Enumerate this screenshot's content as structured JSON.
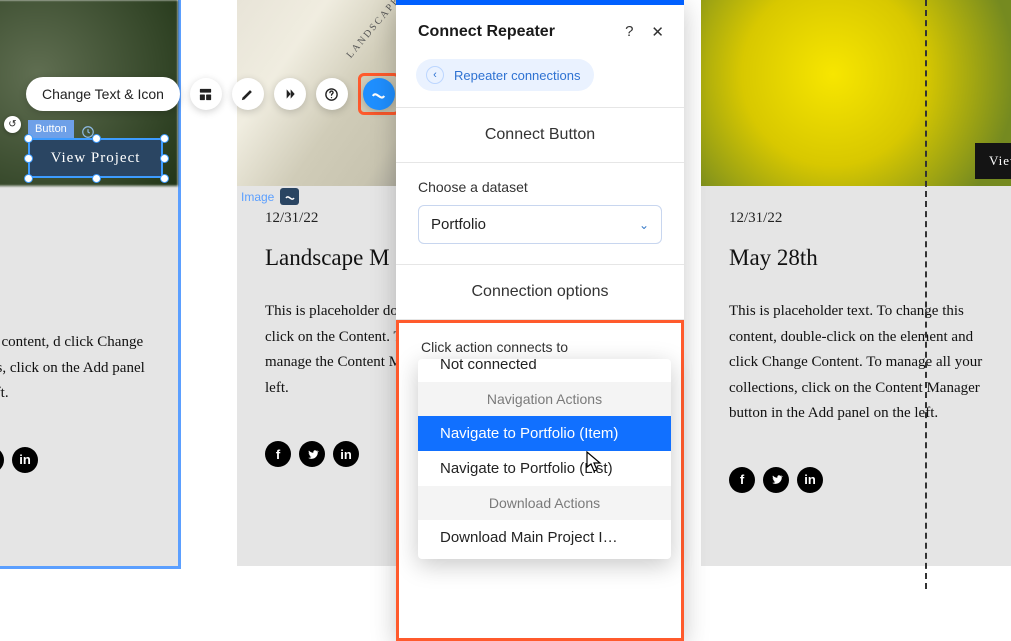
{
  "toolbar": {
    "change_text_label": "Change Text & Icon"
  },
  "selected_element": {
    "type_label": "Button",
    "button_text": "View Project"
  },
  "image_label": "Image",
  "cards": {
    "c1": {
      "text": "ange this content, d click Change ollections, click on the Add panel on the left."
    },
    "c2": {
      "date": "12/31/22",
      "title": "Landscape M",
      "text": "This is placeholder double-click on the Content. To manage the Content Manage left."
    },
    "c3": {
      "date": "12/31/22",
      "title": "May 28th",
      "text": "This is placeholder text. To change this content, double-click on the element and click Change Content. To manage all your collections, click on the Content Manager button in the Add panel on the left.",
      "button_text": "View"
    }
  },
  "panel": {
    "title": "Connect Repeater",
    "repeater_connections_label": "Repeater connections",
    "connect_button_label": "Connect Button",
    "choose_dataset_label": "Choose a dataset",
    "dataset_value": "Portfolio",
    "connection_options_label": "Connection options",
    "click_action_label": "Click action connects to",
    "click_action_value": "vigate to Portfolio (Item)"
  },
  "dropdown": {
    "not_connected": "Not connected",
    "nav_header": "Navigation Actions",
    "item_portfolio_item": "Navigate to Portfolio (Item)",
    "item_portfolio_list": "Navigate to Portfolio (List)",
    "dl_header": "Download Actions",
    "item_download": "Download Main Project I…"
  }
}
